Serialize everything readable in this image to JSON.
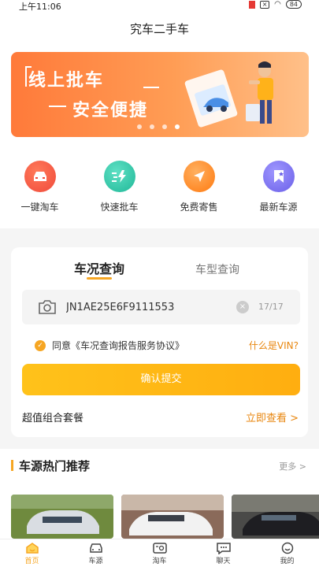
{
  "status": {
    "time": "上午11:06",
    "battery": "84"
  },
  "app": {
    "title": "究车二手车"
  },
  "banner": {
    "line1": "线上批车",
    "line2": "安全便捷",
    "slides": 4,
    "active_slide": 4
  },
  "quick": [
    {
      "label": "一键淘车",
      "icon": "car-icon",
      "color": "#f04a3a"
    },
    {
      "label": "快速批车",
      "icon": "lightning-icon",
      "color": "#2bc6a8"
    },
    {
      "label": "免费寄售",
      "icon": "send-icon",
      "color": "#ff8a1f"
    },
    {
      "label": "最新车源",
      "icon": "bookmark-icon",
      "color": "#7a6ff0"
    }
  ],
  "query": {
    "tab_active": "车况查询",
    "tab_other": "车型查询",
    "vin_value": "JN1AE25E6F9111553",
    "vin_count": "17/17",
    "agree_text": "同意《车况查询报告服务协议》",
    "vin_help": "什么是VIN?",
    "confirm_label": "确认提交",
    "package_label": "超值组合套餐",
    "package_link": "立即查看 >"
  },
  "hot": {
    "title": "车源热门推荐",
    "more": "更多 >"
  },
  "tabbar": [
    {
      "label": "首页",
      "icon": "home-icon",
      "active": true
    },
    {
      "label": "车源",
      "icon": "car-source-icon",
      "active": false
    },
    {
      "label": "淘车",
      "icon": "search-car-icon",
      "active": false
    },
    {
      "label": "聊天",
      "icon": "chat-icon",
      "active": false
    },
    {
      "label": "我的",
      "icon": "profile-icon",
      "active": false
    }
  ],
  "colors": {
    "accent": "#f6a623",
    "link": "#e8860e"
  }
}
